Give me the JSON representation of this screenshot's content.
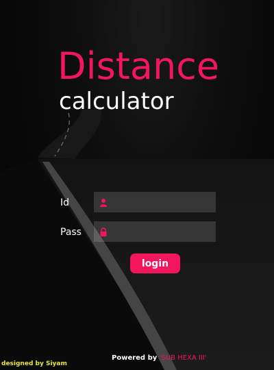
{
  "title": {
    "main": "Distance",
    "sub": "calculator"
  },
  "form": {
    "id_label": "Id",
    "pass_label": "Pass",
    "id_value": "",
    "pass_value": "",
    "id_icon": "user-icon",
    "pass_icon": "lock-icon",
    "login_label": "login"
  },
  "footer": {
    "designed_by": "designed by Siyam",
    "powered_prefix": "Powered by ",
    "powered_brand": "'SUB HEXA III'"
  },
  "colors": {
    "accent": "#f2165e",
    "designed_text": "#e8e63a",
    "background": "#0b0b0b"
  }
}
